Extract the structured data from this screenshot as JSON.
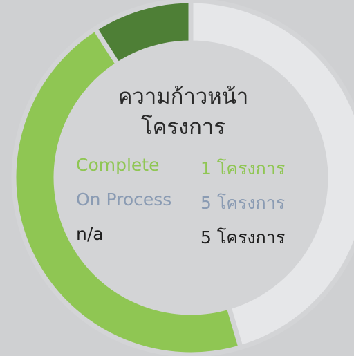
{
  "chart_data": {
    "type": "pie",
    "donut": true,
    "title": "ความก้าวหน้า โครงการ",
    "title_lines": [
      "ความก้าวหน้า",
      "โครงการ"
    ],
    "categories": [
      "Complete",
      "On Process",
      "n/a"
    ],
    "values": [
      1,
      5,
      5
    ],
    "value_labels": [
      "1 โครงการ",
      "5 โครงการ",
      "5 โครงการ"
    ],
    "slice_order": [
      "n/a",
      "On Process",
      "Complete"
    ],
    "colors": {
      "Complete": "#4e7f36",
      "On Process": "#8fc653",
      "n/a": "#e6e7e9"
    },
    "legend_text_colors": {
      "Complete": "#8fc653",
      "On Process": "#8a9bb3",
      "n/a": "#1e1e1e"
    }
  }
}
